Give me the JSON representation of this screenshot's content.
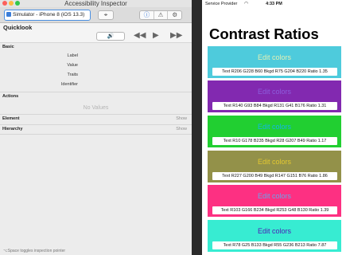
{
  "inspector": {
    "window_title": "Accessibility Inspector",
    "target": "Simulator - iPhone 8 (iOS 13.3)",
    "toolbar": {
      "crosshair_icon": "crosshair-icon",
      "tabs": [
        {
          "icon": "info-icon",
          "glyph": "ⓘ"
        },
        {
          "icon": "warning-icon",
          "glyph": "⚠"
        },
        {
          "icon": "gear-icon",
          "glyph": "⚙"
        }
      ]
    },
    "quicklook": {
      "title": "Quicklook",
      "speak_glyph": "🔊",
      "prev_glyph": "◀◀",
      "play_glyph": "▶",
      "next_glyph": "▶▶"
    },
    "basic": {
      "heading": "Basic",
      "attributes": [
        "Label",
        "Value",
        "Traits",
        "Identifier"
      ]
    },
    "actions": {
      "heading": "Actions",
      "empty_text": "No Values"
    },
    "element": {
      "heading": "Element",
      "show": "Show"
    },
    "hierarchy": {
      "heading": "Hierarchy",
      "show": "Show"
    },
    "footer_hint": "⌥Space toggles inspection pointer"
  },
  "simulator": {
    "status": {
      "carrier": "Service Provider",
      "wifi_icon": "wifi-icon",
      "time": "4:33 PM"
    },
    "title": "Contrast Ratios",
    "cards": [
      {
        "label": "Edit colors",
        "bg": "#4ecbdc",
        "fg": "#e4f0b4",
        "info": "Text R206 G228 B60  Bkgd R75 G204 B220  Ratio 1.35"
      },
      {
        "label": "Edit colors",
        "bg": "#8229b0",
        "fg": "#8c5ddc",
        "info": "Text R140 G93 B84  Bkgd R131 G41 B176  Ratio 1.31"
      },
      {
        "label": "Edit colors",
        "bg": "#21cf31",
        "fg": "#14b4ea",
        "info": "Text R10 G178 B235  Bkgd R28 G207 B49  Ratio 1.17"
      },
      {
        "label": "Edit colors",
        "bg": "#939149",
        "fg": "#e3c831",
        "info": "Text R227 G200 B49  Bkgd R147 G151 B76  Ratio 1.86"
      },
      {
        "label": "Edit colors",
        "bg": "#fd3082",
        "fg": "#67a6ea",
        "info": "Text R103 G166 B234  Bkgd R253 G48 B130  Ratio 1.39"
      },
      {
        "label": "Edit colors",
        "bg": "#37ecd2",
        "fg": "#4e19b6",
        "info": "Text R78 G25 B133  Bkgd R55 G236 B213  Ratio 7.87"
      }
    ]
  }
}
